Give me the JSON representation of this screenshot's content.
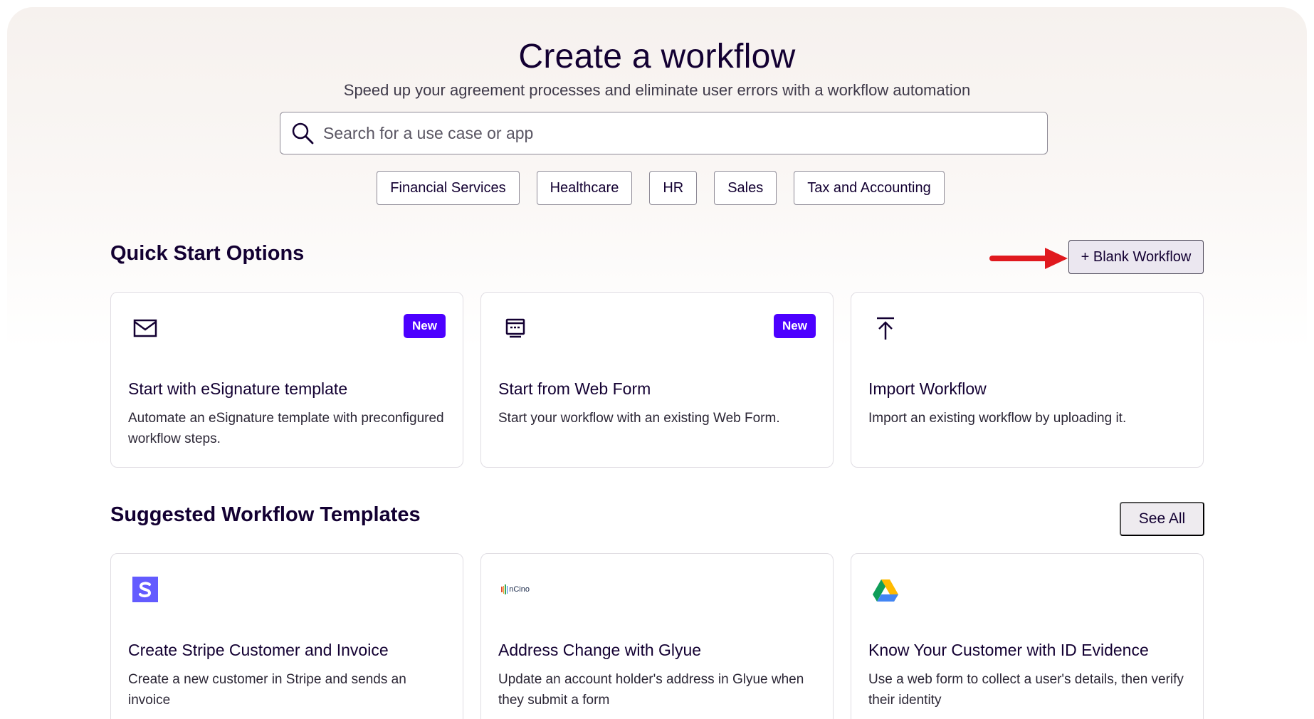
{
  "hero": {
    "title": "Create a workflow",
    "subtitle": "Speed up your agreement processes and eliminate user errors with a workflow automation"
  },
  "search": {
    "placeholder": "Search for a use case or app",
    "value": ""
  },
  "chips": [
    "Financial Services",
    "Healthcare",
    "HR",
    "Sales",
    "Tax and Accounting"
  ],
  "quick_start": {
    "title": "Quick Start Options",
    "blank_button": "+ Blank Workflow",
    "cards": [
      {
        "icon": "envelope-icon",
        "badge": "New",
        "title": "Start with eSignature template",
        "desc": "Automate an eSignature template with preconfigured workflow steps."
      },
      {
        "icon": "web-form-icon",
        "badge": "New",
        "title": "Start from Web Form",
        "desc": "Start your workflow with an existing Web Form."
      },
      {
        "icon": "upload-icon",
        "badge": "",
        "title": "Import Workflow",
        "desc": "Import an existing workflow by uploading it."
      }
    ]
  },
  "suggested": {
    "title": "Suggested Workflow Templates",
    "see_all": "See All",
    "cards": [
      {
        "icon": "stripe-logo-icon",
        "title": "Create Stripe Customer and Invoice",
        "desc": "Create a new customer in Stripe and sends an invoice"
      },
      {
        "icon": "ncino-logo-icon",
        "logo_text": "nCino",
        "title": "Address Change with Glyue",
        "desc": "Update an account holder's address in Glyue when they submit a form"
      },
      {
        "icon": "google-drive-icon",
        "title": "Know Your Customer with ID Evidence",
        "desc": "Use a web form to collect a user's details, then verify their identity"
      }
    ]
  },
  "colors": {
    "accent": "#4c00ff",
    "text": "#130032",
    "annotation_arrow": "#e0191e"
  }
}
